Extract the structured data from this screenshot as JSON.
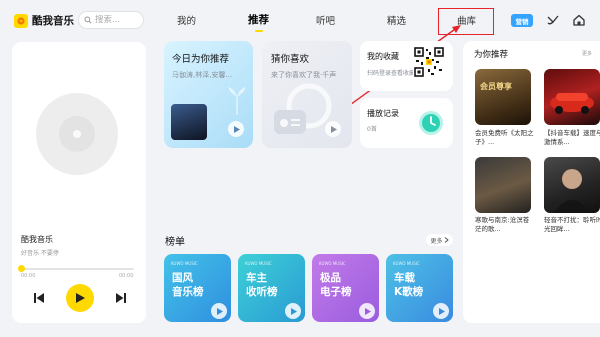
{
  "app": {
    "name": "酷我音乐"
  },
  "search": {
    "placeholder": "搜索..."
  },
  "tabs": [
    {
      "label": "我的"
    },
    {
      "label": "推荐"
    },
    {
      "label": "听吧"
    },
    {
      "label": "精选"
    },
    {
      "label": "曲库"
    }
  ],
  "header": {
    "vip_label": "营销"
  },
  "player": {
    "title": "酷我音乐",
    "subtitle": "好音乐 不要停",
    "time_current": "00:00",
    "time_total": "00:00",
    "progress": 0
  },
  "cards": {
    "daily": {
      "title": "今日为你推荐",
      "subtitle": "马伽涛,林泽,安馨..."
    },
    "guess": {
      "title": "猜你喜欢",
      "subtitle": "来了你喜欢了我·千声"
    },
    "favorites": {
      "title": "我的收藏",
      "subtitle": "扫码登录查看收藏"
    },
    "history": {
      "title": "播放记录",
      "subtitle": "0首"
    }
  },
  "charts_section": {
    "title": "榜单",
    "more": "更多",
    "items": [
      {
        "tag": "KUWO MUSIC",
        "name_line1": "国风",
        "name_line2": "音乐榜",
        "color_from": "#43c2e8",
        "color_to": "#2f8fe0"
      },
      {
        "tag": "KUWO MUSIC",
        "name_line1": "车主",
        "name_line2": "收听榜",
        "color_from": "#3dd0d6",
        "color_to": "#2a9bd4"
      },
      {
        "tag": "KUWO MUSIC",
        "name_line1": "极品",
        "name_line2": "电子榜",
        "color_from": "#c27ae8",
        "color_to": "#9a5ddf"
      },
      {
        "tag": "KUWO MUSIC",
        "name_line1": "车载",
        "name_line2": "K歌榜",
        "color_from": "#4dc1e6",
        "color_to": "#3a8be0"
      }
    ]
  },
  "for_you": {
    "title": "为你推荐",
    "more": "更多",
    "items": [
      {
        "caption": "会员免费听《太阳之子》...",
        "image_text": "会员尊享"
      },
      {
        "caption": "【抖音车载】速度与激情系...",
        "image_text": ""
      },
      {
        "caption": "寒歌与南京:沧溟苍茫的歌...",
        "image_text": ""
      },
      {
        "caption": "轻音不打扰：聆听时光回眸...",
        "image_text": ""
      }
    ]
  },
  "colors": {
    "accent": "#ffd900",
    "vip": "#34a4ff",
    "annotation": "#e8232c"
  }
}
